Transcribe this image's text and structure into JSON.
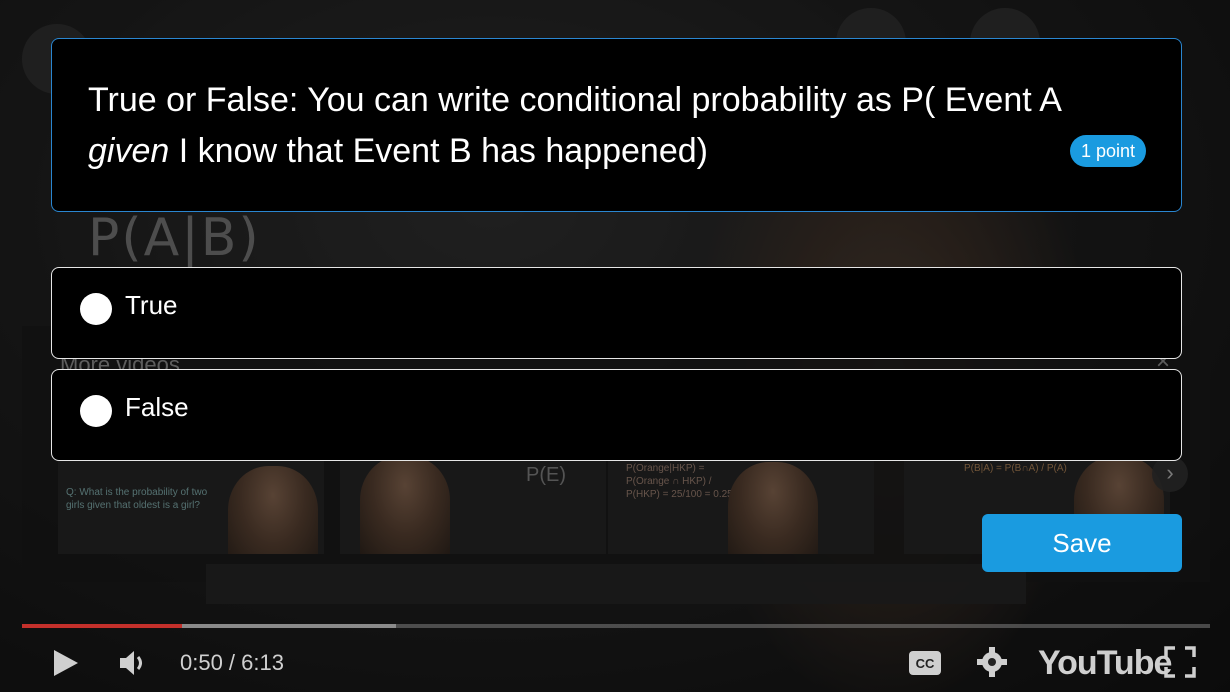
{
  "quiz": {
    "question_part1": "True or False: You can write conditional probability as P( Event A",
    "question_emphasis": "given",
    "question_part2": " I know that Event B has happened)",
    "points": "1 point",
    "options": [
      {
        "label": "True"
      },
      {
        "label": "False"
      }
    ],
    "save_label": "Save",
    "accent_color": "#1a9be0"
  },
  "background": {
    "chalk_text": "P(A|B)",
    "more_videos_title": "More videos",
    "more_videos_close": "×",
    "thumbnails": [
      {
        "caption": "Q: What is the probability of two girls given that oldest is a girl?"
      },
      {
        "caption": "P(E)"
      },
      {
        "caption": "P(Orange|HKP) = P(Orange ∩ HKP) / P(HKP) = 25/100 = 0.25"
      },
      {
        "caption": ""
      },
      {
        "caption": "P(B|A) = P(B∩A) / P(A)"
      }
    ]
  },
  "player": {
    "time": "0:50 / 6:13",
    "progress_fraction": 0.135,
    "buffer_fraction": 0.315,
    "progress_color": "#c4302b",
    "logo": "YouTube",
    "icons": [
      "play-icon",
      "volume-icon",
      "cc-icon",
      "gear-icon",
      "fullscreen-icon"
    ]
  }
}
